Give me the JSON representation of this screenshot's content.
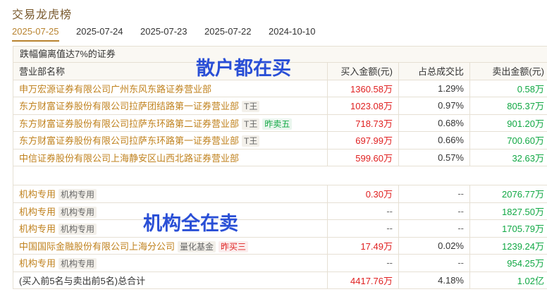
{
  "title": "交易龙虎榜",
  "tabs": [
    {
      "label": "2025-07-25",
      "active": true
    },
    {
      "label": "2025-07-24",
      "active": false
    },
    {
      "label": "2025-07-23",
      "active": false
    },
    {
      "label": "2025-07-22",
      "active": false
    },
    {
      "label": "2024-10-10",
      "active": false
    }
  ],
  "section_title": "跌幅偏离值达7%的证券",
  "headers": {
    "name": "营业部名称",
    "buy": "买入金额(元)",
    "ratio": "占总成交比",
    "sell": "卖出金额(元)"
  },
  "buy_rows": [
    {
      "name": "申万宏源证券有限公司广州东风东路证券营业部",
      "tags": [],
      "buy": "1360.58万",
      "ratio": "1.29%",
      "sell": "0.58万"
    },
    {
      "name": "东方财富证券股份有限公司拉萨团结路第一证券营业部",
      "tags": [
        {
          "text": "T王",
          "style": "gray"
        }
      ],
      "buy": "1023.08万",
      "ratio": "0.97%",
      "sell": "805.37万"
    },
    {
      "name": "东方财富证券股份有限公司拉萨东环路第二证券营业部",
      "tags": [
        {
          "text": "T王",
          "style": "gray"
        },
        {
          "text": "昨卖五",
          "style": "green"
        }
      ],
      "buy": "718.73万",
      "ratio": "0.68%",
      "sell": "901.20万"
    },
    {
      "name": "东方财富证券股份有限公司拉萨东环路第一证券营业部",
      "tags": [
        {
          "text": "T王",
          "style": "gray"
        }
      ],
      "buy": "697.99万",
      "ratio": "0.66%",
      "sell": "700.60万"
    },
    {
      "name": "中信证券股份有限公司上海静安区山西北路证券营业部",
      "tags": [],
      "buy": "599.60万",
      "ratio": "0.57%",
      "sell": "32.63万"
    }
  ],
  "sell_rows": [
    {
      "name": "机构专用",
      "tags": [
        {
          "text": "机构专用",
          "style": "gray"
        }
      ],
      "buy": "0.30万",
      "ratio": "--",
      "sell": "2076.77万"
    },
    {
      "name": "机构专用",
      "tags": [
        {
          "text": "机构专用",
          "style": "gray"
        }
      ],
      "buy": "--",
      "ratio": "--",
      "sell": "1827.50万"
    },
    {
      "name": "机构专用",
      "tags": [
        {
          "text": "机构专用",
          "style": "gray"
        }
      ],
      "buy": "--",
      "ratio": "--",
      "sell": "1705.79万"
    },
    {
      "name": "中国国际金融股份有限公司上海分公司",
      "tags": [
        {
          "text": "量化基金",
          "style": "gray"
        },
        {
          "text": "昨买三",
          "style": "red"
        }
      ],
      "buy": "17.49万",
      "ratio": "0.02%",
      "sell": "1239.24万"
    },
    {
      "name": "机构专用",
      "tags": [
        {
          "text": "机构专用",
          "style": "gray"
        }
      ],
      "buy": "--",
      "ratio": "--",
      "sell": "954.25万"
    }
  ],
  "total_row": {
    "name": "(买入前5名与卖出前5名)总合计",
    "buy": "4417.76万",
    "ratio": "4.18%",
    "sell": "1.02亿"
  },
  "overlays": {
    "buy_note": "散户都在买",
    "sell_note": "机构全在卖"
  },
  "colors": {
    "accent": "#b8832f",
    "buy": "#e02020",
    "sell": "#11a844",
    "overlay": "#2a4fd6"
  }
}
